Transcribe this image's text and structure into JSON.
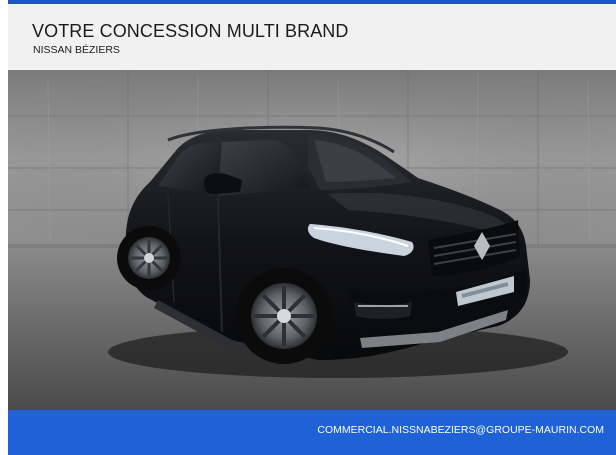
{
  "header": {
    "title": "VOTRE CONCESSION MULTI BRAND",
    "subtitle": "NISSAN BÉZIERS"
  },
  "photo": {
    "subject_icon": "car-photo"
  },
  "footer": {
    "email": "COMMERCIAL.NISSNABEZIERS@GROUPE-MAURIN.COM"
  },
  "colors": {
    "accent_blue": "#1f61d6",
    "header_bg": "#f1f1f1",
    "car_body": "#121316"
  }
}
